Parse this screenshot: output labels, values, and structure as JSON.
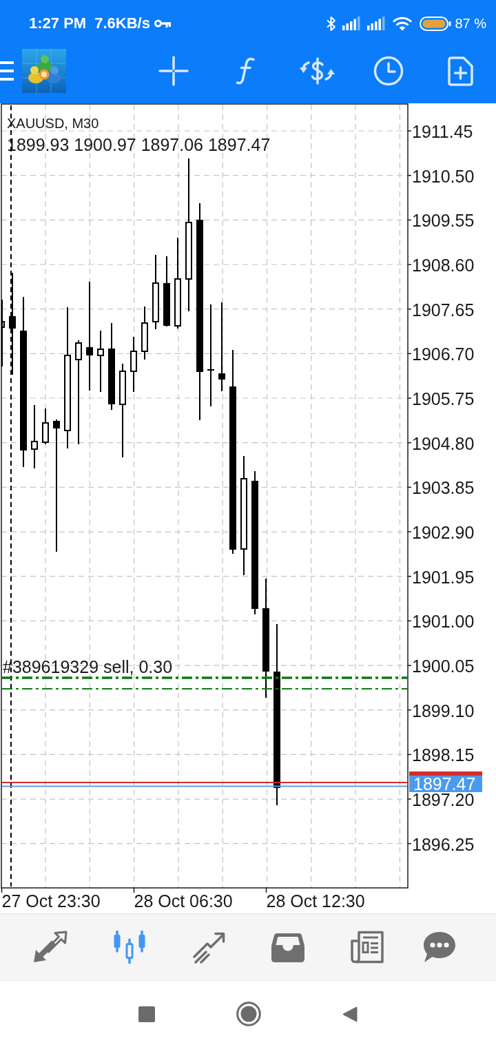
{
  "status_bar": {
    "time": "1:27 PM",
    "network_speed": "7.6KB/s",
    "battery_percent": "87 %"
  },
  "chart": {
    "symbol": "XAUUSD, M30",
    "ohlc": "1899.93 1900.97 1897.06 1897.47",
    "order_label": "#389619329 sell, 0.30",
    "price_labels": [
      "1911.45",
      "1910.50",
      "1909.55",
      "1908.60",
      "1907.65",
      "1906.70",
      "1905.75",
      "1904.80",
      "1903.85",
      "1902.90",
      "1901.95",
      "1901.00",
      "1900.05",
      "1899.10",
      "1898.15",
      "1897.20",
      "1896.25"
    ],
    "bid_price": "1897.47",
    "time_labels": [
      "27 Oct 23:30",
      "28 Oct 06:30",
      "28 Oct 12:30"
    ]
  },
  "bottom_nav": [
    {
      "selected": false
    },
    {
      "selected": true
    },
    {
      "selected": false
    },
    {
      "selected": false
    },
    {
      "selected": false
    },
    {
      "selected": false
    }
  ]
}
